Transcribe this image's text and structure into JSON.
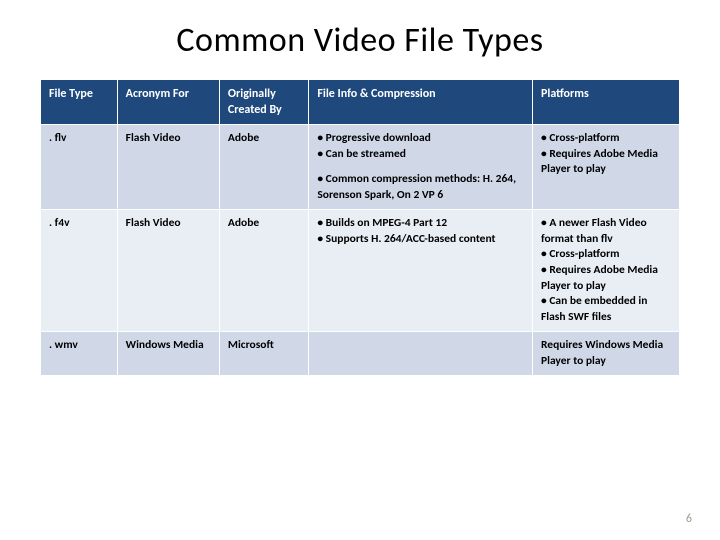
{
  "title": "Common Video File Types",
  "page_number": "6",
  "table": {
    "headers": [
      "File Type",
      "Acronym For",
      "Originally Created By",
      "File Info & Compression",
      "Platforms"
    ],
    "rows": [
      {
        "file_type": ". flv",
        "acronym": "Flash Video",
        "creator": "Adobe",
        "info_a": "• Progressive download\n• Can be streamed",
        "info_b": "• Common compression methods: H. 264, Sorenson Spark, On 2 VP 6",
        "platforms": "• Cross-platform\n• Requires Adobe Media Player to play"
      },
      {
        "file_type": ". f4v",
        "acronym": "Flash Video",
        "creator": "Adobe",
        "info_a": "• Builds on MPEG-4 Part 12\n• Supports H. 264/ACC-based content",
        "info_b": "",
        "platforms": "• A newer Flash Video format than flv\n• Cross-platform\n• Requires Adobe Media Player to play\n• Can be embedded in Flash SWF files"
      },
      {
        "file_type": ". wmv",
        "acronym": "Windows Media",
        "creator": "Microsoft",
        "info_a": "",
        "info_b": "",
        "platforms": "Requires Windows Media Player to play"
      }
    ]
  }
}
